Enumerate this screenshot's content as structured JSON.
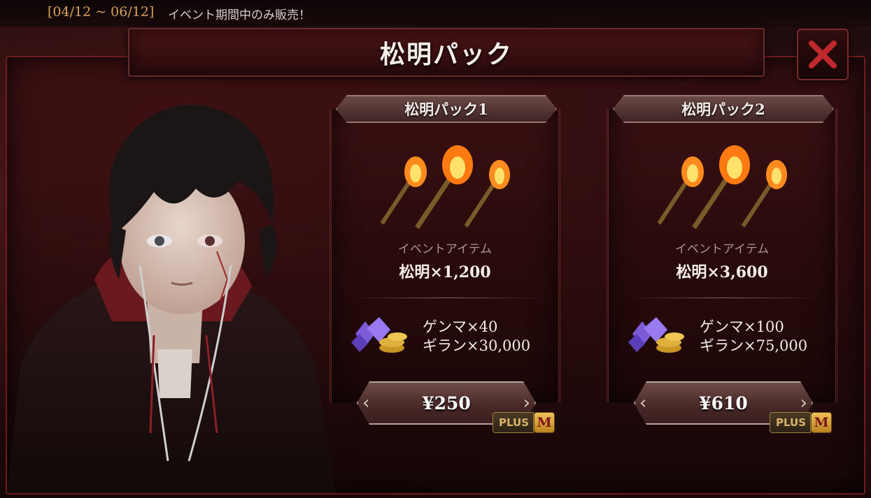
{
  "banner": {
    "period": "[04/12 ~ 06/12]",
    "note": "イベント期間中のみ販売！"
  },
  "header": {
    "title": "松明パック"
  },
  "packs": [
    {
      "name": "松明パック1",
      "item_label": "イベントアイテム",
      "item_qty": "松明×1,200",
      "bonus_line1": "ゲンマ×40",
      "bonus_line2": "ギラン×30,000",
      "price": "¥250",
      "badge_plus": "PLUS",
      "badge_m": "M"
    },
    {
      "name": "松明パック2",
      "item_label": "イベントアイテム",
      "item_qty": "松明×3,600",
      "bonus_line1": "ゲンマ×100",
      "bonus_line2": "ギラン×75,000",
      "price": "¥610",
      "badge_plus": "PLUS",
      "badge_m": "M"
    }
  ],
  "colors": {
    "accent_red": "#c0282c",
    "frame_red": "#6e1c1f",
    "gold": "#d9a25a"
  },
  "icons": [
    "close-icon",
    "torch-icon",
    "gem-coin-icon",
    "chevron-left-icon",
    "chevron-right-icon"
  ]
}
